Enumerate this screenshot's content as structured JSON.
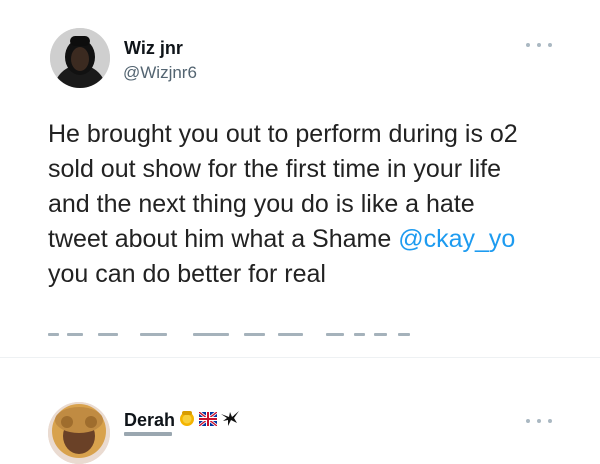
{
  "tweet": {
    "author": {
      "name": "Wiz jnr",
      "handle": "@Wizjnr6"
    },
    "text": {
      "line1": "He brought you out to perform during is o2",
      "line2": "sold out show for the first time in your life",
      "line3": "and the next thing you do is like a hate",
      "line4_prefix": "tweet about him what a Shame ",
      "mention": "@ckay_yo",
      "line5": "you can do better for real"
    },
    "more_icon": "more-dots-icon"
  },
  "reply": {
    "author": {
      "name": "Derah"
    },
    "badges": [
      "gold-pot-emoji",
      "uk-flag-emoji",
      "eagle-emoji"
    ],
    "more_icon": "more-dots-icon"
  },
  "colors": {
    "link": "#1d9bf0",
    "secondary_text": "#536471",
    "primary_text": "#0f1419"
  }
}
